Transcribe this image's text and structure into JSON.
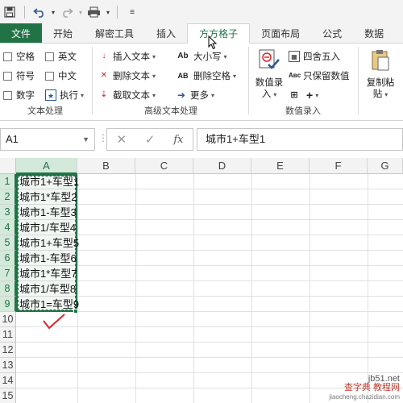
{
  "quick_access": {
    "icons": [
      "save-icon",
      "undo-icon",
      "redo-icon",
      "print-icon",
      "customize-icon"
    ]
  },
  "ribbon_tabs": [
    {
      "label": "文件"
    },
    {
      "label": "开始"
    },
    {
      "label": "解密工具"
    },
    {
      "label": "插入"
    },
    {
      "label": "方方格子"
    },
    {
      "label": "页面布局"
    },
    {
      "label": "公式"
    },
    {
      "label": "数据"
    }
  ],
  "active_tab": "方方格子",
  "ribbon": {
    "text_group": {
      "label": "文本处理",
      "checkboxes": [
        "空格",
        "英文",
        "符号",
        "中文",
        "数字"
      ],
      "execute_label": "执行"
    },
    "advanced_group": {
      "label": "高级文本处理",
      "insert_text": "插入文本",
      "delete_text": "删除文本",
      "extract_text": "截取文本",
      "case_label": "大小写",
      "delete_space": "删除空格",
      "more_label": "更多"
    },
    "number_group": {
      "label": "数值录入",
      "number_entry_line1": "数值录",
      "number_entry_line2": "入",
      "round_label": "四舍五入",
      "keep_value": "只保留数值",
      "plus_label": "+"
    },
    "copy_paste": {
      "line1": "复制粘",
      "line2": "贴"
    }
  },
  "formula_bar": {
    "name_box": "A1",
    "cancel_symbol": "✕",
    "confirm_symbol": "✓",
    "fx_label": "fx",
    "content": "城市1+车型1"
  },
  "sheet": {
    "columns": [
      "A",
      "B",
      "C",
      "D",
      "E",
      "F",
      "G"
    ],
    "rows": [
      "1",
      "2",
      "3",
      "4",
      "5",
      "6",
      "7",
      "8",
      "9",
      "10",
      "11",
      "12",
      "13",
      "14",
      "15"
    ],
    "cells_a": [
      "城市1+车型1",
      "城市1*车型2",
      "城市1-车型3",
      "城市1/车型4",
      "城市1+车型5",
      "城市1-车型6",
      "城市1*车型7",
      "城市1/车型8",
      "城市1=车型9"
    ]
  },
  "watermark": {
    "line1": "jb51.net",
    "line2": "查字典 教程网",
    "line3": "jiaocheng.chazidian.com"
  },
  "colors": {
    "excel_green": "#217346",
    "header_bg": "#f3f3f3",
    "check_red": "#d9262d"
  }
}
